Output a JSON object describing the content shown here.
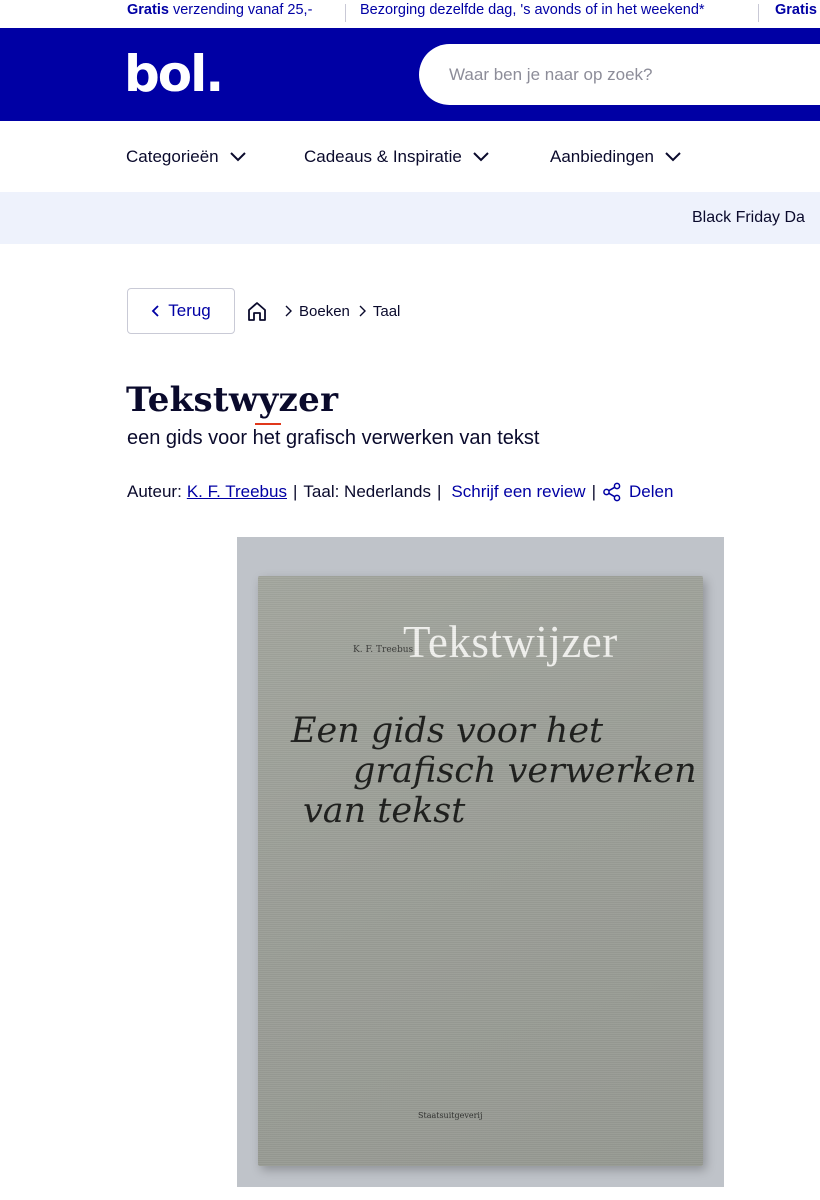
{
  "topbar": {
    "msg1_bold": "Gratis",
    "msg1_rest": " verzending vanaf 25,-",
    "msg2": "Bezorging dezelfde dag, 's avonds of in het weekend*",
    "msg3_bold": "Gratis"
  },
  "header": {
    "logo": "bol.",
    "search_placeholder": "Waar ben je naar op zoek?"
  },
  "nav": {
    "items": [
      {
        "label": "Categorieën"
      },
      {
        "label": "Cadeaus & Inspiratie"
      },
      {
        "label": "Aanbiedingen"
      }
    ]
  },
  "promo": {
    "text": "Black Friday Da"
  },
  "breadcrumb": {
    "back_label": "Terug",
    "items": [
      {
        "label": "Boeken"
      },
      {
        "label": "Taal"
      }
    ]
  },
  "product": {
    "title": "Tekstwyzer",
    "subtitle": "een gids voor het grafisch verwerken van tekst",
    "author_prefix": "Auteur:",
    "author": "K. F. Treebus",
    "language": "Taal: Nederlands",
    "review_link": "Schrijf een review",
    "share_label": "Delen"
  },
  "cover": {
    "author": "K. F. Treebus",
    "title": "Tekstwijzer",
    "subtitle_lines": [
      "Een gids voor het",
      "grafisch verwerken",
      "van tekst"
    ],
    "publisher": "Staatsuitgeverij"
  },
  "colors": {
    "brand": "#0000a4",
    "accent": "#e0381b",
    "promo_bg": "#eef2fc"
  }
}
